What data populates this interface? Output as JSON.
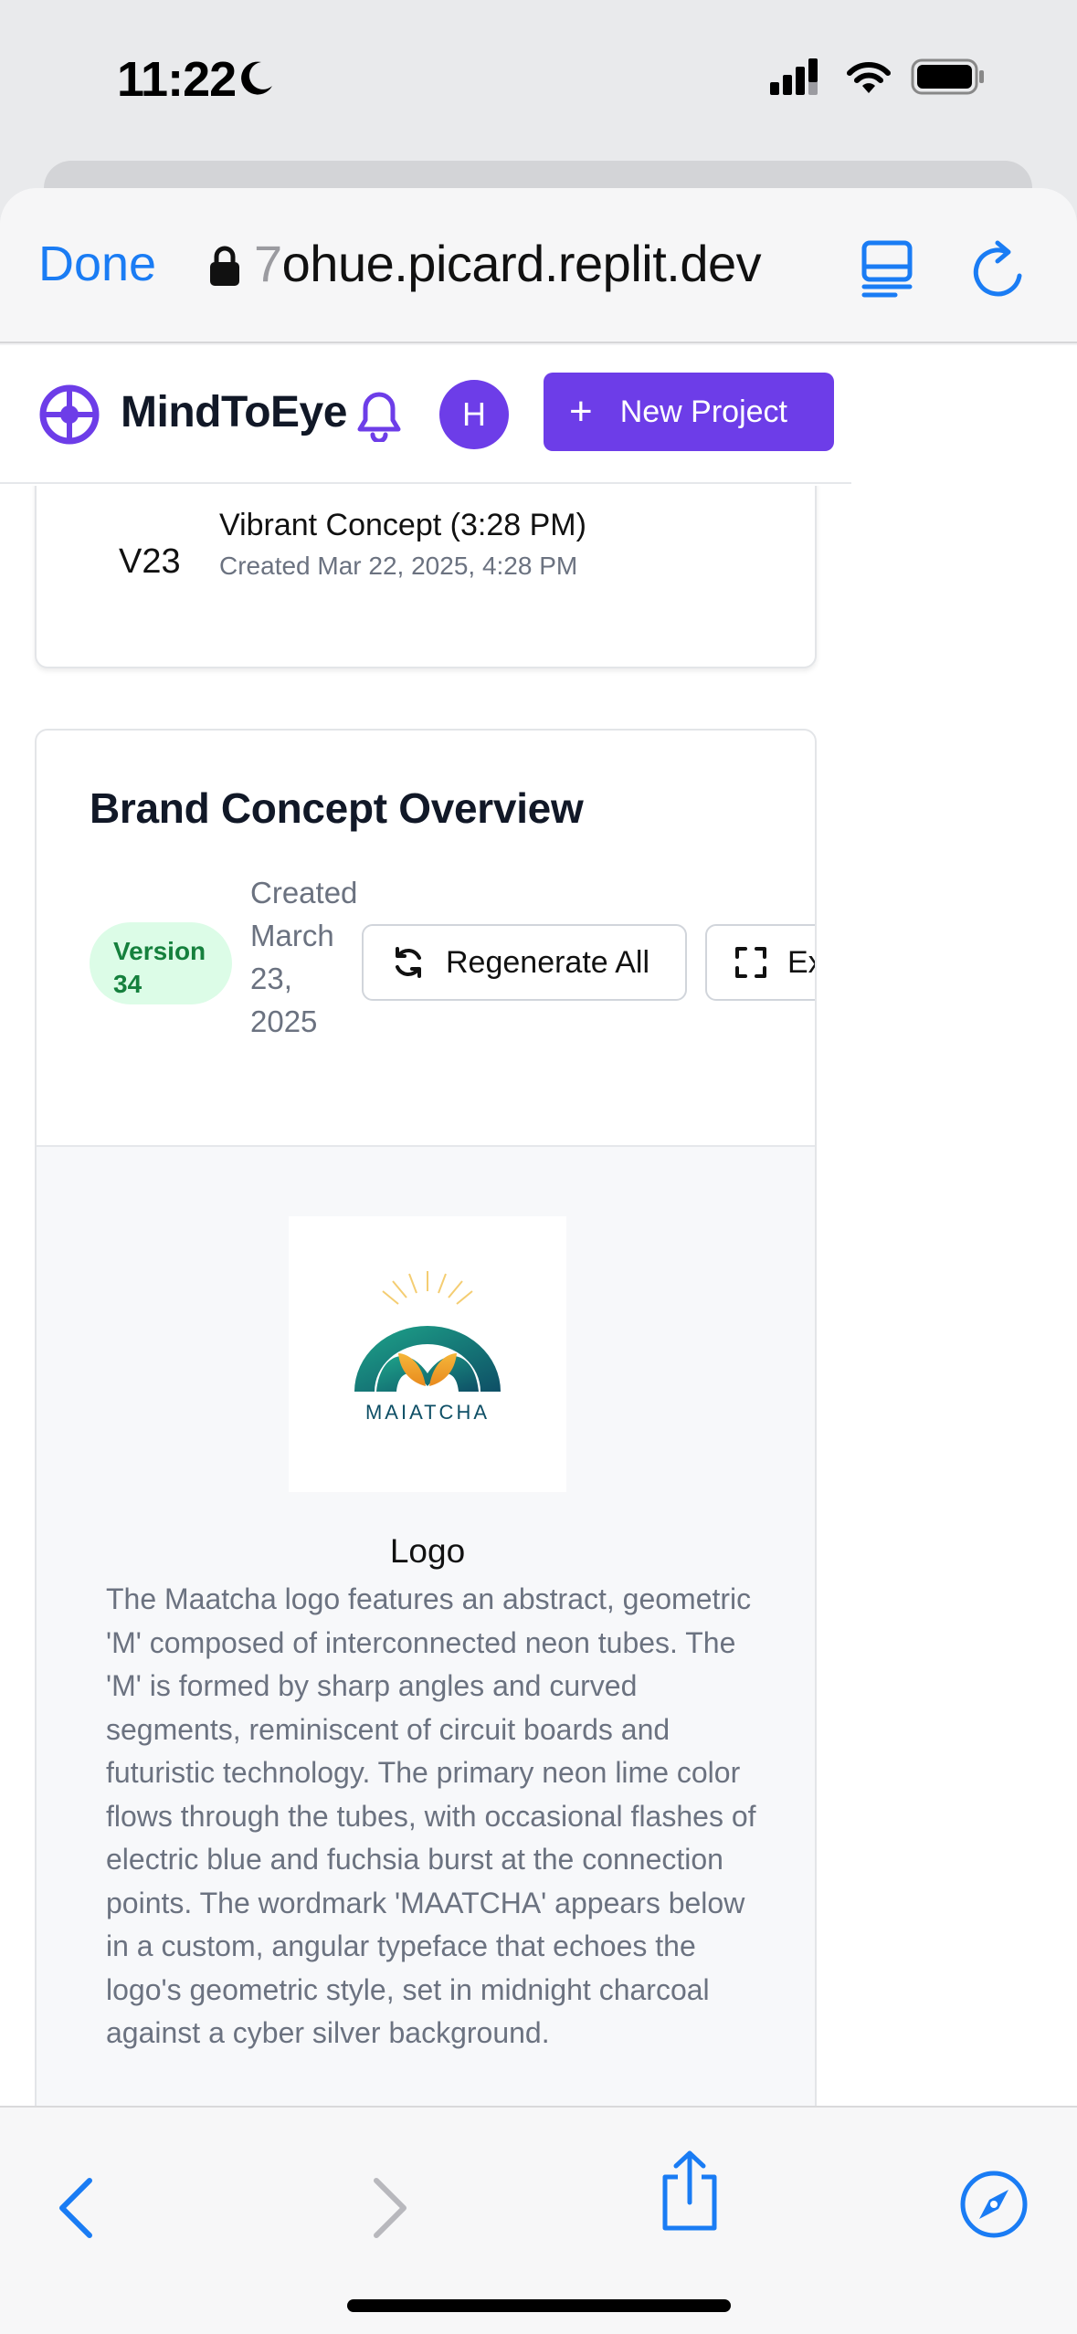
{
  "status_bar": {
    "time": "11:22"
  },
  "browser": {
    "done_label": "Done",
    "url_faded": "7",
    "url_main": "ohue.picard.replit.dev"
  },
  "app": {
    "brand_name": "MindToEye",
    "avatar_initial": "H",
    "new_project_label": "New Project",
    "accent_color": "#6d3de8"
  },
  "version_item": {
    "label": "V23",
    "title": "Vibrant Concept (3:28 PM)",
    "created": "Created Mar 22, 2025, 4:28 PM"
  },
  "overview": {
    "title": "Brand Concept Overview",
    "version_badge": "Version 34",
    "created": "Created March 23, 2025",
    "regenerate_label": "Regenerate All",
    "expand_label": "Ex"
  },
  "asset": {
    "logo_wordmark": "MAIATCHA",
    "title": "Logo",
    "description": "The Maatcha logo features an abstract, geometric 'M' composed of interconnected neon tubes. The 'M' is formed by sharp angles and curved segments, reminiscent of circuit boards and futuristic technology. The primary neon lime color flows through the tubes, with occasional flashes of electric blue and fuchsia burst at the connection points. The wordmark 'MAATCHA' appears below in a custom, angular typeface that echoes the logo's geometric style, set in midnight charcoal against a cyber silver background."
  }
}
